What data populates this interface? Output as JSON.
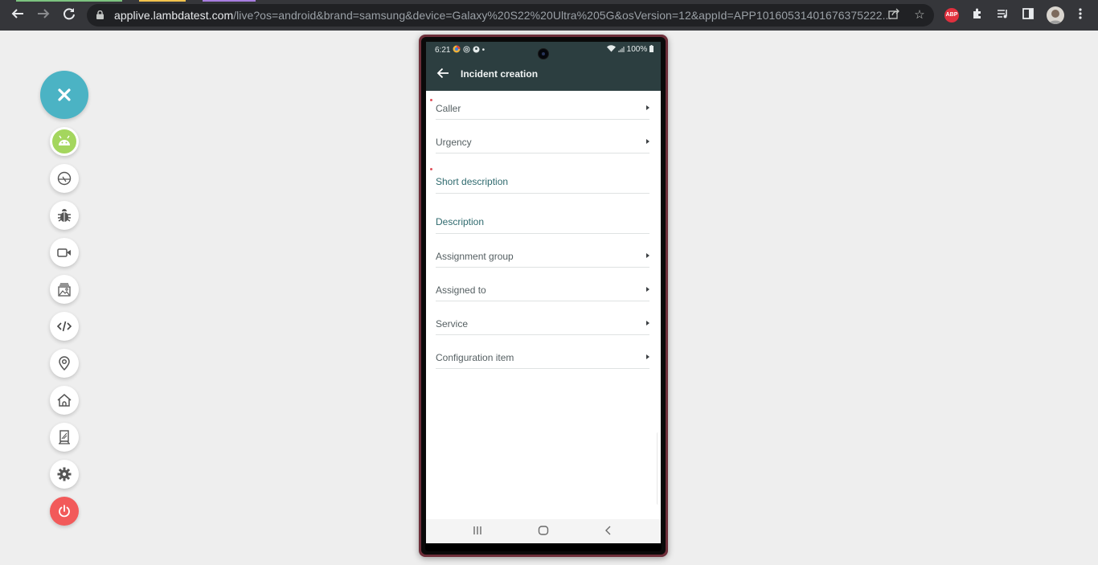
{
  "browser": {
    "tab_colors": [
      "#7cc37f",
      "#f1c24d",
      "#a77de0"
    ],
    "url_domain": "applive.lambdatest.com",
    "url_path": "/live?os=android&brand=samsung&device=Galaxy%20S22%20Ultra%205G&osVersion=12&appId=APP101605314016763752​22...",
    "extensions": [
      "abp-icon",
      "puzzle-extensions-icon",
      "media-queue-icon",
      "side-panel-icon",
      "profile-avatar",
      "menu-icon"
    ],
    "abp_label": "ABP"
  },
  "toolbar": {
    "close_color": "#4bb3c4",
    "android_color": "#a4d65e",
    "power_color": "#f25a5a",
    "items": [
      "android",
      "rotate",
      "bug",
      "video",
      "gallery",
      "code",
      "location",
      "home",
      "device",
      "settings",
      "power"
    ]
  },
  "phone": {
    "status": {
      "time": "6:21",
      "battery": "100%"
    },
    "appbar": {
      "title": "Incident creation"
    },
    "fields": [
      {
        "label": "Caller",
        "required": true,
        "type": "reference"
      },
      {
        "label": "Urgency",
        "required": false,
        "type": "reference"
      },
      {
        "label": "Short description",
        "required": true,
        "type": "text"
      },
      {
        "label": "Description",
        "required": false,
        "type": "text"
      },
      {
        "label": "Assignment group",
        "required": false,
        "type": "reference"
      },
      {
        "label": "Assigned to",
        "required": false,
        "type": "reference"
      },
      {
        "label": "Service",
        "required": false,
        "type": "reference"
      },
      {
        "label": "Configuration item",
        "required": false,
        "type": "reference"
      }
    ]
  }
}
